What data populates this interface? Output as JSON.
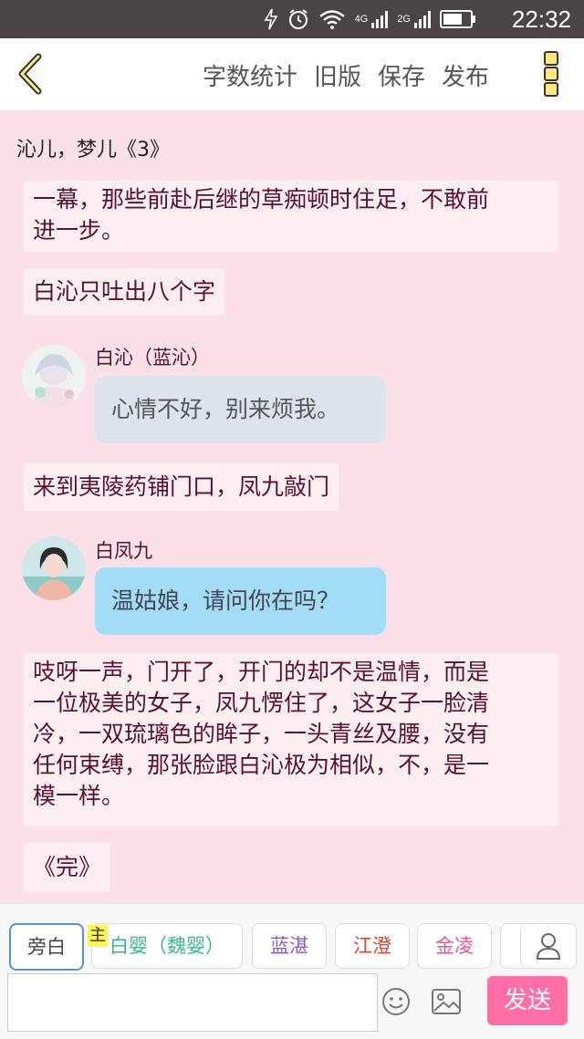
{
  "status_bar": {
    "time": "22:32",
    "net1": "4G",
    "net2": "2G",
    "icons": [
      "bolt-icon",
      "alarm-icon",
      "wifi-icon",
      "signal-icon",
      "battery-icon"
    ]
  },
  "toolbar": {
    "word_count": "字数统计",
    "old_version": "旧版",
    "save": "保存",
    "publish": "发布"
  },
  "chapter_title": "沁儿，梦儿《3》",
  "messages": {
    "narration_1_line1": "一幕，那些前赴后继的草痴顿时住足，不敢前",
    "narration_1_line2": "进一步。",
    "narration_2": "白沁只吐出八个字",
    "speaker_1": "白沁（蓝沁）",
    "bubble_1": "心情不好，别来烦我。",
    "narration_3": "来到夷陵药铺门口，凤九敲门",
    "speaker_2": "白凤九",
    "bubble_2": "温姑娘，请问你在吗？",
    "narration_4_lines": [
      "吱呀一声，门开了，开门的却不是温情，而是",
      "一位极美的女子，凤九愣住了，这女子一脸清",
      "冷，一双琉璃色的眸子，一头青丝及腰，没有",
      "任何束缚，那张脸跟白沁极为相似，不，是一",
      "模一样。"
    ],
    "narration_5": "《完》"
  },
  "roles": {
    "narrator": "旁白",
    "main_badge": "主",
    "role_1": "白婴（魏婴）",
    "role_2": "蓝湛",
    "role_3": "江澄",
    "role_4": "金凌"
  },
  "composer": {
    "input_value": "",
    "send": "发送"
  },
  "colors": {
    "background": "#fbe0e8",
    "narration_bg": "#fdeef2",
    "bubble_grey": "#dde3ea",
    "bubble_blue": "#a3dcf5",
    "send": "#ff6fa5",
    "role_1": "#39b98a",
    "role_2": "#8a5cc6",
    "role_3": "#e0452c",
    "role_4": "#e25a8f"
  }
}
